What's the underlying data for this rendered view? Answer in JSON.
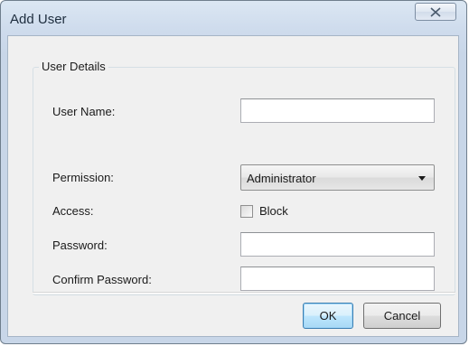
{
  "window": {
    "title": "Add User",
    "close_icon": "close-x-icon"
  },
  "group": {
    "legend": "User Details"
  },
  "fields": {
    "username": {
      "label": "User Name:",
      "value": ""
    },
    "permission": {
      "label": "Permission:",
      "selected": "Administrator"
    },
    "access": {
      "label": "Access:",
      "checkbox_label": "Block",
      "checked": false
    },
    "password": {
      "label": "Password:",
      "value": ""
    },
    "confirm_password": {
      "label": "Confirm Password:",
      "value": ""
    }
  },
  "buttons": {
    "ok_label": "OK",
    "cancel_label": "Cancel"
  },
  "colors": {
    "title_bar": "#cfdced",
    "client_bg": "#f0f0f0",
    "default_button_border": "#3c7fb1"
  }
}
